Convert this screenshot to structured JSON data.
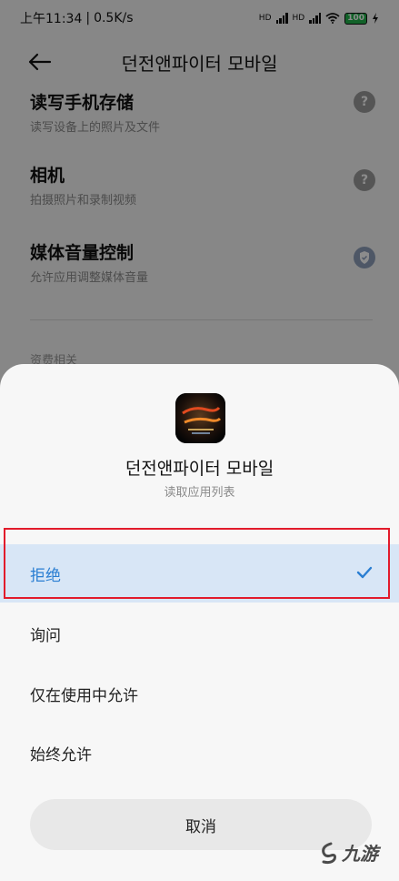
{
  "status_bar": {
    "time": "上午11:34",
    "separator": "|",
    "speed": "0.5K/s",
    "sim1": "HD",
    "sim2": "HD",
    "battery": "100"
  },
  "header": {
    "title": "던전앤파이터 모바일"
  },
  "permissions": [
    {
      "title": "读写手机存储",
      "subtitle": "读写设备上的照片及文件",
      "badge": "?"
    },
    {
      "title": "相机",
      "subtitle": "拍摄照片和录制视频",
      "badge": "?"
    },
    {
      "title": "媒体音量控制",
      "subtitle": "允许应用调整媒体音量",
      "badge": "shield"
    }
  ],
  "section_label": "资费相关",
  "sheet": {
    "app_name": "던전앤파이터 모바일",
    "subtitle": "读取应用列表",
    "options": [
      {
        "label": "拒绝",
        "selected": true
      },
      {
        "label": "询问",
        "selected": false
      },
      {
        "label": "仅在使用中允许",
        "selected": false
      },
      {
        "label": "始终允许",
        "selected": false
      }
    ],
    "cancel_label": "取消"
  },
  "watermark": {
    "text": "九游"
  },
  "colors": {
    "accent": "#2a7ed2",
    "selected_bg": "#d8e6f6",
    "highlight_border": "#e21b2b",
    "battery": "#21b24b"
  }
}
